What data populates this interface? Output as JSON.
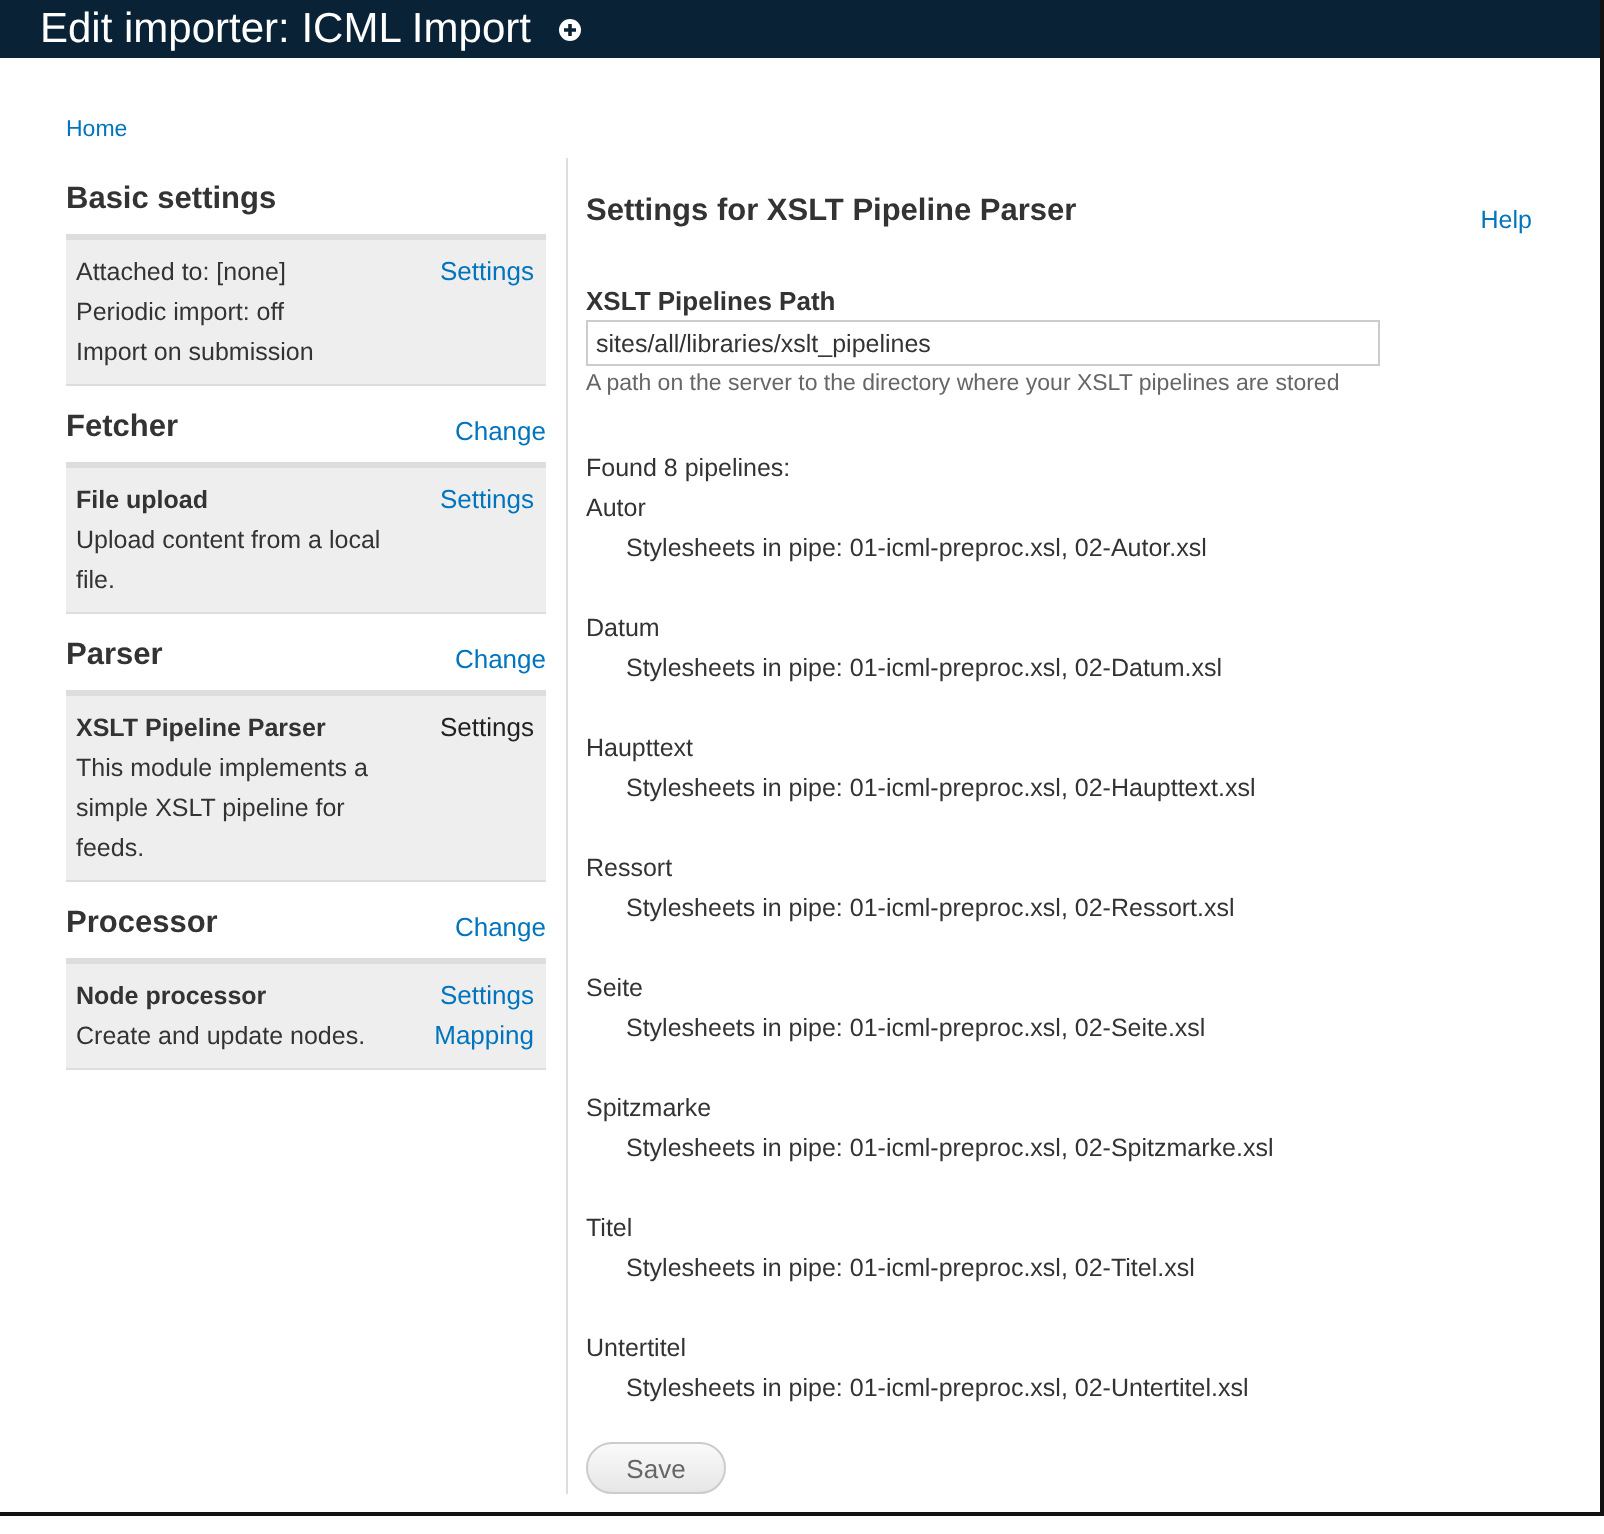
{
  "window": {
    "title": "Edit importer: ICML Import"
  },
  "breadcrumb": [
    "Home"
  ],
  "sidebar": [
    {
      "title": "Basic settings",
      "box": {
        "lines": [
          "Attached to: [none]",
          "Periodic import: off",
          "Import on submission"
        ],
        "links": [
          {
            "label": "Settings",
            "selected": false
          }
        ]
      }
    },
    {
      "title": "Fetcher",
      "action": "Change",
      "box": {
        "heading": "File upload",
        "lines": [
          "Upload content from a local file."
        ],
        "links": [
          {
            "label": "Settings",
            "selected": false
          }
        ]
      }
    },
    {
      "title": "Parser",
      "action": "Change",
      "box": {
        "heading": "XSLT Pipeline Parser",
        "lines": [
          "This module implements a simple XSLT pipeline for feeds."
        ],
        "links": [
          {
            "label": "Settings",
            "selected": true
          }
        ]
      }
    },
    {
      "title": "Processor",
      "action": "Change",
      "box": {
        "heading": "Node processor",
        "lines": [
          "Create and update nodes."
        ],
        "links": [
          {
            "label": "Settings",
            "selected": false
          },
          {
            "label": "Mapping",
            "selected": false
          }
        ]
      }
    }
  ],
  "main": {
    "title": "Settings for XSLT Pipeline Parser",
    "help": "Help",
    "field": {
      "label": "XSLT Pipelines Path",
      "value": "sites/all/libraries/xslt_pipelines",
      "description": "A path on the server to the directory where your XSLT pipelines are stored"
    },
    "found": "Found 8 pipelines:",
    "pipelines": [
      {
        "name": "Autor",
        "stylesheets": "Stylesheets in pipe: 01-icml-preproc.xsl, 02-Autor.xsl"
      },
      {
        "name": "Datum",
        "stylesheets": "Stylesheets in pipe: 01-icml-preproc.xsl, 02-Datum.xsl"
      },
      {
        "name": "Haupttext",
        "stylesheets": "Stylesheets in pipe: 01-icml-preproc.xsl, 02-Haupttext.xsl"
      },
      {
        "name": "Ressort",
        "stylesheets": "Stylesheets in pipe: 01-icml-preproc.xsl, 02-Ressort.xsl"
      },
      {
        "name": "Seite",
        "stylesheets": "Stylesheets in pipe: 01-icml-preproc.xsl, 02-Seite.xsl"
      },
      {
        "name": "Spitzmarke",
        "stylesheets": "Stylesheets in pipe: 01-icml-preproc.xsl, 02-Spitzmarke.xsl"
      },
      {
        "name": "Titel",
        "stylesheets": "Stylesheets in pipe: 01-icml-preproc.xsl, 02-Titel.xsl"
      },
      {
        "name": "Untertitel",
        "stylesheets": "Stylesheets in pipe: 01-icml-preproc.xsl, 02-Untertitel.xsl"
      }
    ],
    "save": "Save"
  }
}
